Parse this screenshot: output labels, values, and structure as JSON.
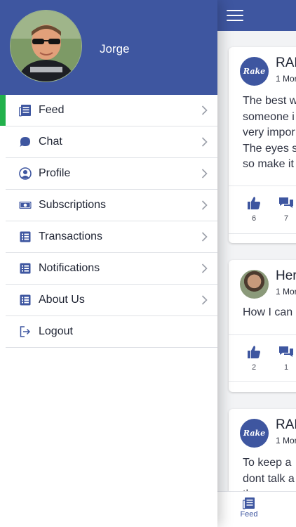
{
  "colors": {
    "brand": "#3e56a0",
    "active_marker": "#22b14c"
  },
  "drawer": {
    "user_name": "Jorge",
    "avatar": "user-photo",
    "menu": [
      {
        "label": "Feed",
        "icon": "newspaper-icon",
        "active": true
      },
      {
        "label": "Chat",
        "icon": "chat-bubble-icon"
      },
      {
        "label": "Profile",
        "icon": "user-circle-icon"
      },
      {
        "label": "Subscriptions",
        "icon": "money-icon"
      },
      {
        "label": "Transactions",
        "icon": "list-icon"
      },
      {
        "label": "Notifications",
        "icon": "list-icon"
      },
      {
        "label": "About Us",
        "icon": "list-icon"
      },
      {
        "label": "Logout",
        "icon": "logout-icon"
      }
    ]
  },
  "feed": {
    "posts": [
      {
        "author": "RAK",
        "date": "1 Mor",
        "body": "The best w\nsomeone i\nvery impor\nThe eyes s\nso make it",
        "likes": "6",
        "comments": "7"
      },
      {
        "author": "Her",
        "date": "1 Mor",
        "body": "How I can",
        "likes": "2",
        "comments": "1"
      },
      {
        "author": "RAK",
        "date": "1 Mor",
        "body": "To keep a\ndont talk a\nth",
        "likes": "",
        "comments": ""
      }
    ],
    "logo_text": "Rake"
  },
  "bottom_nav": {
    "feed_label": "Feed"
  }
}
